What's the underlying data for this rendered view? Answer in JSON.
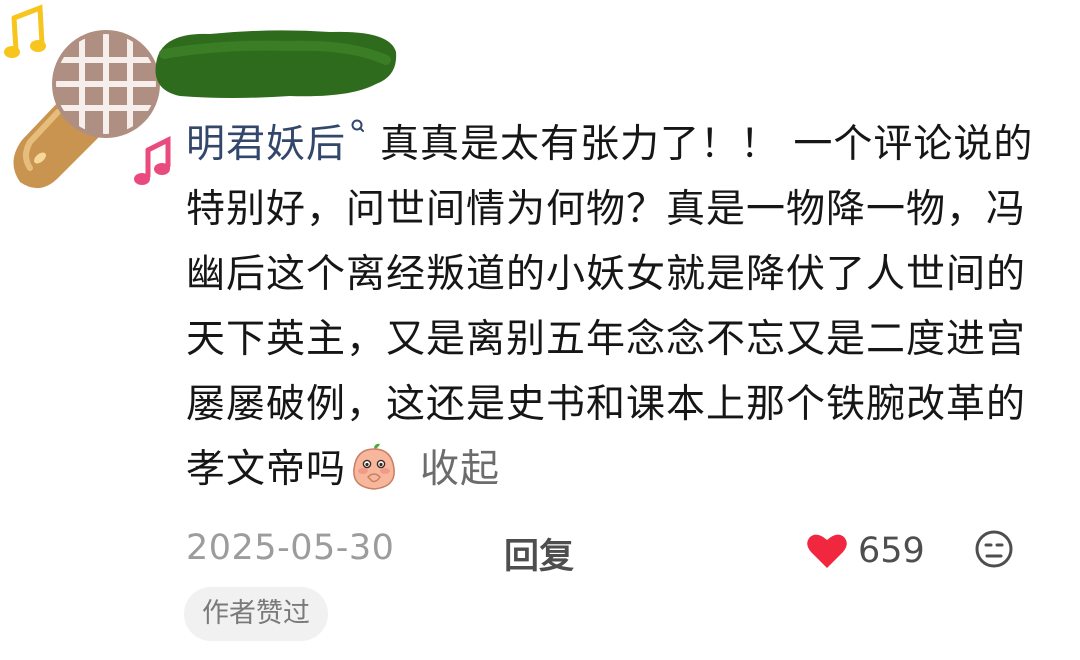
{
  "comment": {
    "username": "明君妖后",
    "text": "真真是太有张力了！！ 一个评论说的特别好，问世间情为何物？真是一物降一物，冯幽后这个离经叛道的小妖女就是降伏了人世间的天下英主，又是离别五年念念不忘又是二度进宫屡屡破例，这还是史书和课本上那个铁腕改革的孝文帝吗",
    "emoji": "peach-shy-emoji",
    "collapse_label": "收起"
  },
  "footer": {
    "date": "2025-05-30",
    "reply_label": "回复",
    "like_count": "659",
    "badge": "作者赞过"
  },
  "icons": {
    "avatar": "microphone-avatar",
    "like": "heart-icon",
    "dislike": "frown-face-icon",
    "username_mark": "search-mark-icon"
  },
  "colors": {
    "username": "#33476b",
    "heart": "#f0273f",
    "date": "#9c9c9c",
    "badge_bg": "#f1f1f1"
  }
}
